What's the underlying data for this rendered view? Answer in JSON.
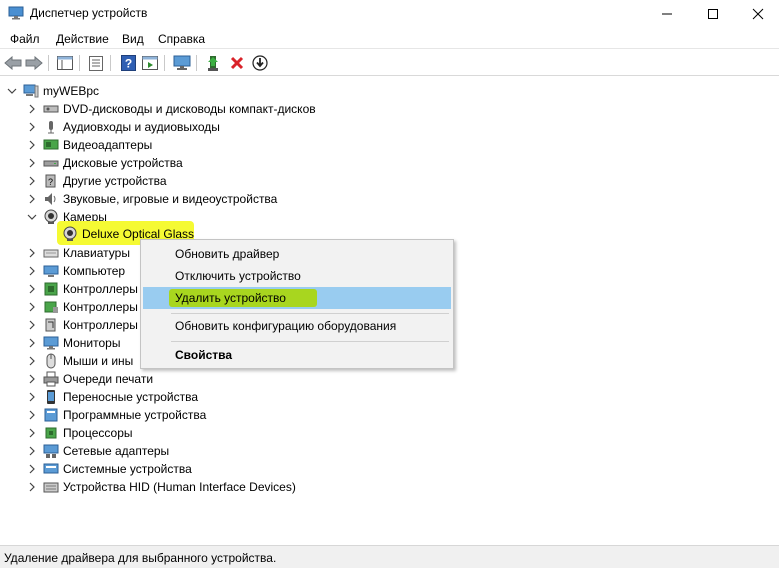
{
  "window": {
    "title": "Диспетчер устройств"
  },
  "menu": [
    "Файл",
    "Действие",
    "Вид",
    "Справка"
  ],
  "toolbar": {
    "buttons": [
      "back-icon",
      "forward-icon",
      "properties-panel-icon",
      "list-icon",
      "help-icon",
      "scan-icon",
      "monitor-icon",
      "update-driver-icon",
      "uninstall-icon",
      "download-icon"
    ]
  },
  "tree": {
    "root": "myWEBpc",
    "categories": [
      "DVD-дисководы и дисководы компакт-дисков",
      "Аудиовходы и аудиовыходы",
      "Видеоадаптеры",
      "Дисковые устройства",
      "Другие устройства",
      "Звуковые, игровые и видеоустройства",
      "Камеры",
      "Клавиатуры",
      "Компьютер",
      "Контроллеры",
      "Контроллеры",
      "Контроллеры",
      "Мониторы",
      "Мыши и ины",
      "Очереди печати",
      "Переносные устройства",
      "Программные устройства",
      "Процессоры",
      "Сетевые адаптеры",
      "Системные устройства",
      "Устройства HID (Human Interface Devices)"
    ],
    "selected_device": "Deluxe Optical Glass"
  },
  "context_menu": {
    "items": [
      "Обновить драйвер",
      "Отключить устройство",
      "Удалить устройство",
      "Обновить конфигурацию оборудования",
      "Свойства"
    ]
  },
  "status": "Удаление драйвера для выбранного устройства.",
  "colors": {
    "highlight": "#f5fa33",
    "menu_selection": "#99ccf0",
    "menu_highlight_marker": "#a8d61f",
    "uninstall_red": "#d9232a"
  }
}
